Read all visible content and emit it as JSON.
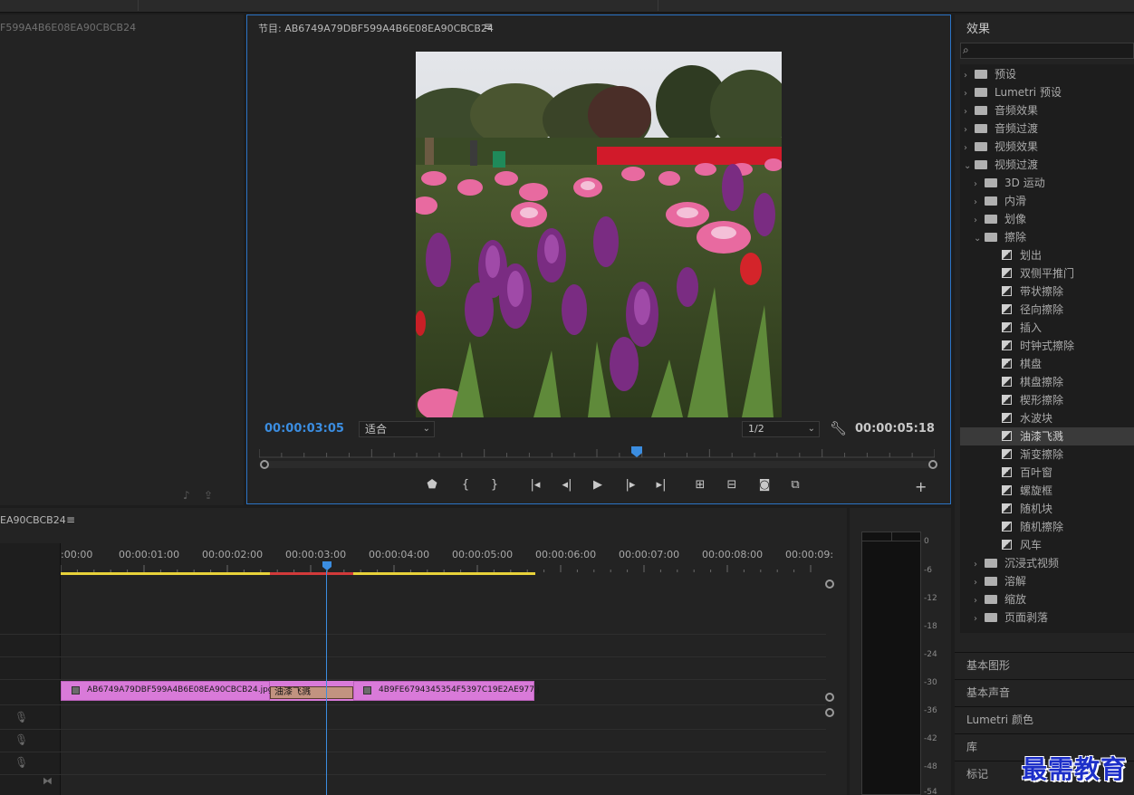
{
  "source_panel": {
    "title": "F599A4B6E08EA90CBCB24",
    "icons": [
      "audio-insert-icon",
      "export-icon"
    ]
  },
  "program_monitor": {
    "title": "节目: AB6749A79DBF599A4B6E08EA90CBCB24",
    "menu_icon": "≡",
    "current_time": "00:00:03:05",
    "fit_label": "适合",
    "resolution_label": "1/2",
    "duration": "00:00:05:18",
    "controls": [
      "marker",
      "mark-in",
      "mark-out",
      "go-to-in",
      "step-back",
      "play",
      "step-forward",
      "go-to-out",
      "lift",
      "extract",
      "export-frame",
      "compare"
    ],
    "add_label": "+"
  },
  "timeline": {
    "title": "EA90CBCB24",
    "menu_icon": "≡",
    "ticks": [
      ":00:00",
      "00:00:01:00",
      "00:00:02:00",
      "00:00:03:00",
      "00:00:04:00",
      "00:00:05:00",
      "00:00:06:00",
      "00:00:07:00",
      "00:00:08:00",
      "00:00:09:"
    ],
    "clip_a_label": "AB6749A79DBF599A4B6E08EA90CBCB24.jpg",
    "clip_b_label": "4B9FE6794345354F5397C19E2AE977.j",
    "transition_label": "油漆飞溅",
    "colors": {
      "clip": "#d97ad9",
      "transition": "#c29380",
      "playhead": "#3b8de0",
      "work_yellow": "#e8d23a",
      "work_red": "#d23a3a"
    }
  },
  "audio_meter": {
    "db_labels": [
      "0",
      "-6",
      "-12",
      "-18",
      "-24",
      "-30",
      "-36",
      "-42",
      "-48",
      "-54"
    ]
  },
  "effects": {
    "title": "效果",
    "search_placeholder": "",
    "tree": [
      {
        "label": "预设",
        "level": 0,
        "kind": "preset-folder",
        "expanded": false
      },
      {
        "label": "Lumetri 预设",
        "level": 0,
        "kind": "preset-folder",
        "expanded": false
      },
      {
        "label": "音频效果",
        "level": 0,
        "kind": "folder",
        "expanded": false
      },
      {
        "label": "音频过渡",
        "level": 0,
        "kind": "folder",
        "expanded": false
      },
      {
        "label": "视频效果",
        "level": 0,
        "kind": "folder",
        "expanded": false
      },
      {
        "label": "视频过渡",
        "level": 0,
        "kind": "folder",
        "expanded": true
      },
      {
        "label": "3D 运动",
        "level": 1,
        "kind": "folder",
        "expanded": false
      },
      {
        "label": "内滑",
        "level": 1,
        "kind": "folder",
        "expanded": false
      },
      {
        "label": "划像",
        "level": 1,
        "kind": "folder",
        "expanded": false
      },
      {
        "label": "擦除",
        "level": 1,
        "kind": "folder",
        "expanded": true
      },
      {
        "label": "划出",
        "level": 2,
        "kind": "effect"
      },
      {
        "label": "双侧平推门",
        "level": 2,
        "kind": "effect"
      },
      {
        "label": "带状擦除",
        "level": 2,
        "kind": "effect"
      },
      {
        "label": "径向擦除",
        "level": 2,
        "kind": "effect"
      },
      {
        "label": "插入",
        "level": 2,
        "kind": "effect"
      },
      {
        "label": "时钟式擦除",
        "level": 2,
        "kind": "effect"
      },
      {
        "label": "棋盘",
        "level": 2,
        "kind": "effect"
      },
      {
        "label": "棋盘擦除",
        "level": 2,
        "kind": "effect"
      },
      {
        "label": "楔形擦除",
        "level": 2,
        "kind": "effect"
      },
      {
        "label": "水波块",
        "level": 2,
        "kind": "effect"
      },
      {
        "label": "油漆飞溅",
        "level": 2,
        "kind": "effect",
        "selected": true
      },
      {
        "label": "渐变擦除",
        "level": 2,
        "kind": "effect"
      },
      {
        "label": "百叶窗",
        "level": 2,
        "kind": "effect"
      },
      {
        "label": "螺旋框",
        "level": 2,
        "kind": "effect"
      },
      {
        "label": "随机块",
        "level": 2,
        "kind": "effect"
      },
      {
        "label": "随机擦除",
        "level": 2,
        "kind": "effect"
      },
      {
        "label": "风车",
        "level": 2,
        "kind": "effect"
      },
      {
        "label": "沉浸式视频",
        "level": 1,
        "kind": "folder",
        "expanded": false
      },
      {
        "label": "溶解",
        "level": 1,
        "kind": "folder",
        "expanded": false
      },
      {
        "label": "缩放",
        "level": 1,
        "kind": "folder",
        "expanded": false
      },
      {
        "label": "页面剥落",
        "level": 1,
        "kind": "folder",
        "expanded": false
      }
    ],
    "sections": [
      "基本图形",
      "基本声音",
      "Lumetri 颜色",
      "库",
      "标记"
    ]
  },
  "watermark": "最需教育"
}
